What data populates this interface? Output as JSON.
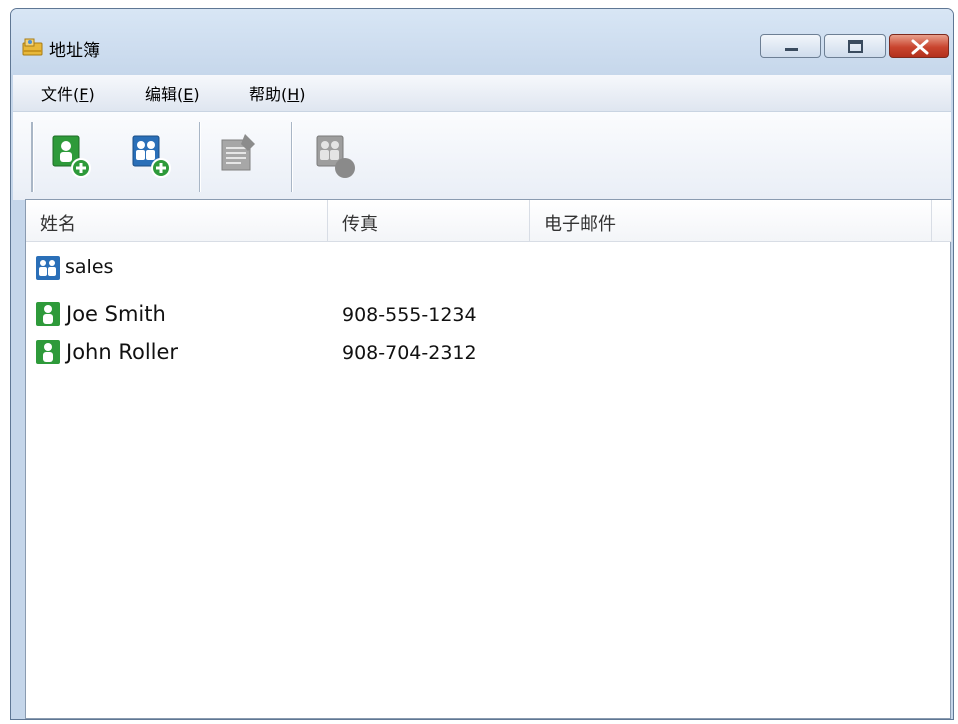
{
  "window": {
    "title": "地址簿"
  },
  "menu": [
    {
      "label": "文件(",
      "key": "F",
      "suffix": ")"
    },
    {
      "label": "编辑(",
      "key": "E",
      "suffix": ")"
    },
    {
      "label": "帮助(",
      "key": "H",
      "suffix": ")"
    }
  ],
  "toolbar": {
    "buttons": [
      {
        "icon": "add-contact-icon",
        "enabled": true
      },
      {
        "icon": "add-group-icon",
        "enabled": true
      },
      {
        "icon": "edit-icon",
        "enabled": false
      },
      {
        "icon": "delete-icon",
        "enabled": false
      }
    ]
  },
  "list": {
    "columns": [
      "姓名",
      "传真",
      "电子邮件"
    ],
    "rows": [
      {
        "type": "group",
        "icon": "group-icon",
        "name": "sales",
        "fax": "",
        "email": ""
      },
      {
        "type": "contact",
        "icon": "contact-icon",
        "name": "Joe Smith",
        "fax": "908-555-1234",
        "email": ""
      },
      {
        "type": "contact",
        "icon": "contact-icon",
        "name": "John Roller",
        "fax": "908-704-2312",
        "email": ""
      }
    ]
  },
  "colors": {
    "accent_green": "#2e9a3a",
    "accent_blue": "#2a6fb8",
    "close_red": "#c9452f"
  }
}
